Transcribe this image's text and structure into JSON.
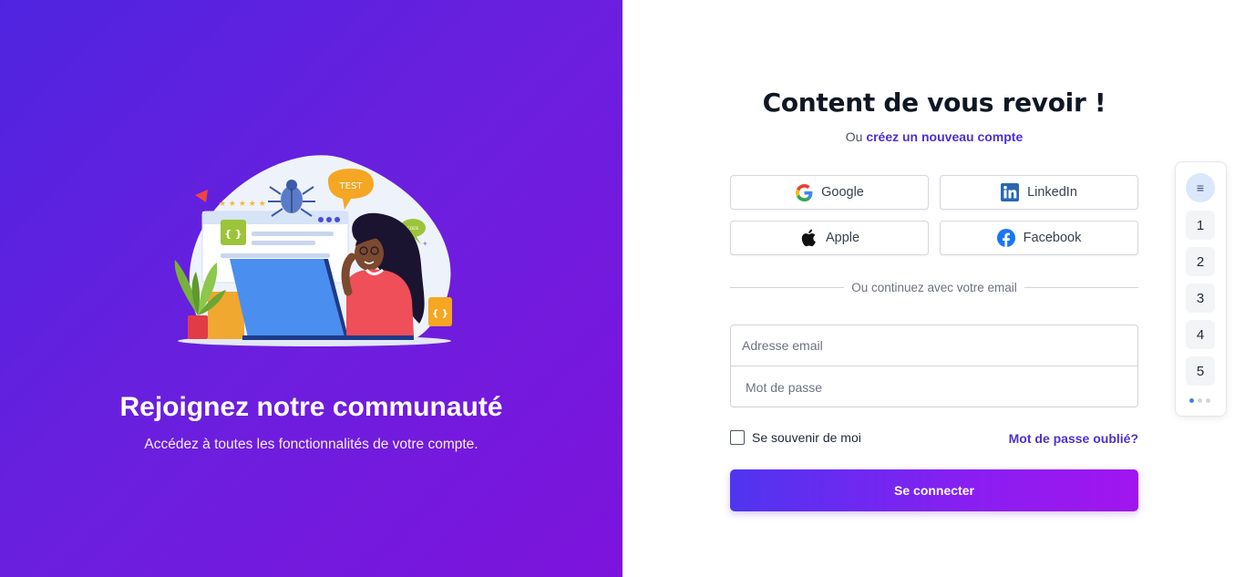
{
  "hero": {
    "title": "Rejoignez notre communauté",
    "subtitle": "Accédez à toutes les fonctionnalités de votre compte.",
    "illustration": {
      "bubble_test": "TEST",
      "bubble_code": "CODE"
    }
  },
  "form": {
    "title": "Content de vous revoir !",
    "subtitle_prefix": "Ou",
    "subtitle_link": "créez un nouveau compte",
    "social": {
      "google": "Google",
      "linkedin": "LinkedIn",
      "apple": "Apple",
      "facebook": "Facebook"
    },
    "divider_text": "Ou continuez avec votre email",
    "email_placeholder": "Adresse email",
    "password_placeholder": "Mot de passe",
    "remember_label": "Se souvenir de moi",
    "forgot_link": "Mot de passe oublié?",
    "submit_label": "Se connecter"
  },
  "side_nav": {
    "menu_icon": "≡",
    "items": [
      "1",
      "2",
      "3",
      "4",
      "5"
    ],
    "active_dot": 0
  },
  "colors": {
    "gradient_start": "#4f24e0",
    "gradient_end": "#7d13dc",
    "accent_link": "#4f2ed1",
    "button_gradient_start": "#4f35ef",
    "button_gradient_end": "#a115ef"
  }
}
